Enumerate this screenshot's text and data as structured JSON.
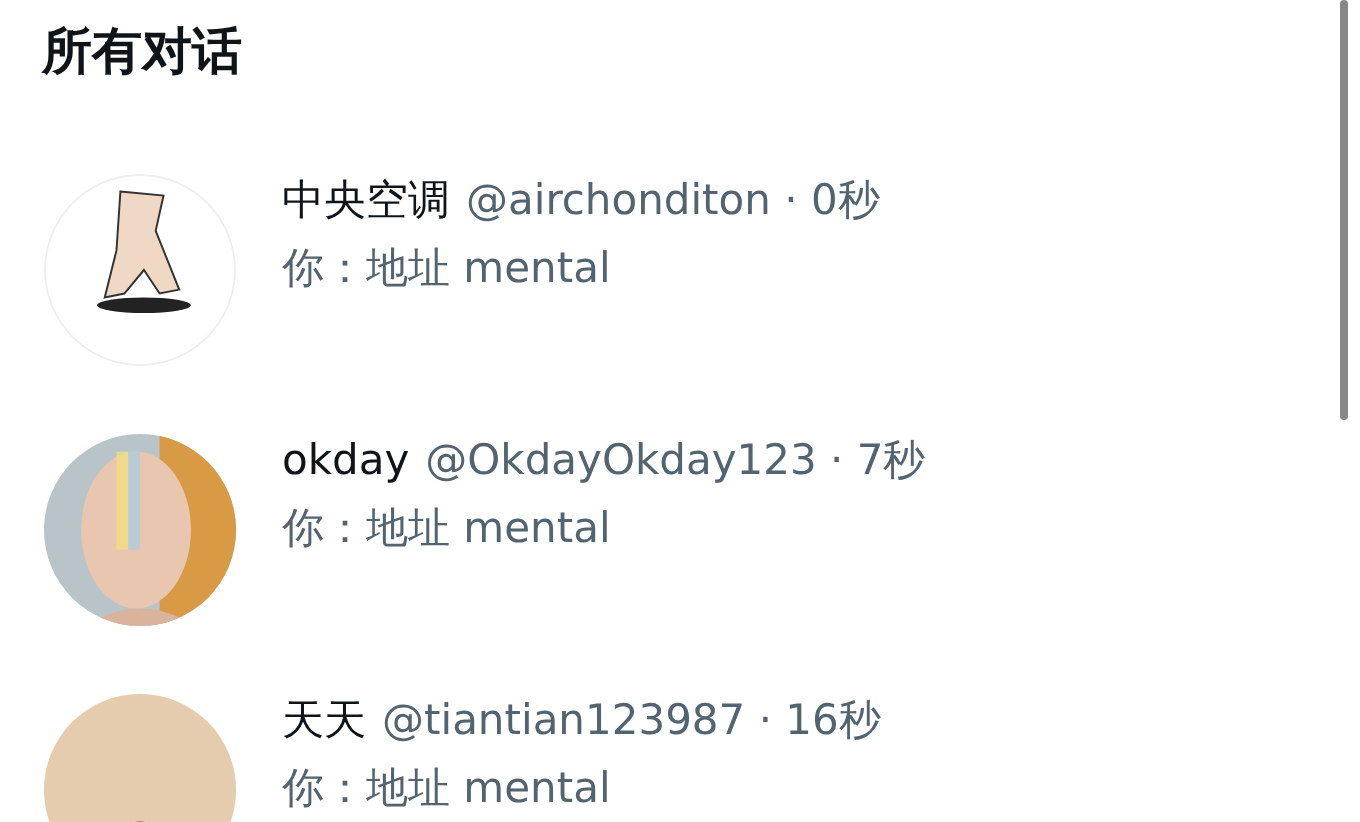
{
  "title": "所有对话",
  "conversations": [
    {
      "name": "中央空调",
      "meta": "@airchonditon · 0秒",
      "preview": "你：地址 mental"
    },
    {
      "name": "okday",
      "meta": "@OkdayOkday123 · 7秒",
      "preview": "你：地址 mental"
    },
    {
      "name": "天天",
      "meta": "@tiantian123987 · 16秒",
      "preview": "你：地址 mental"
    }
  ]
}
